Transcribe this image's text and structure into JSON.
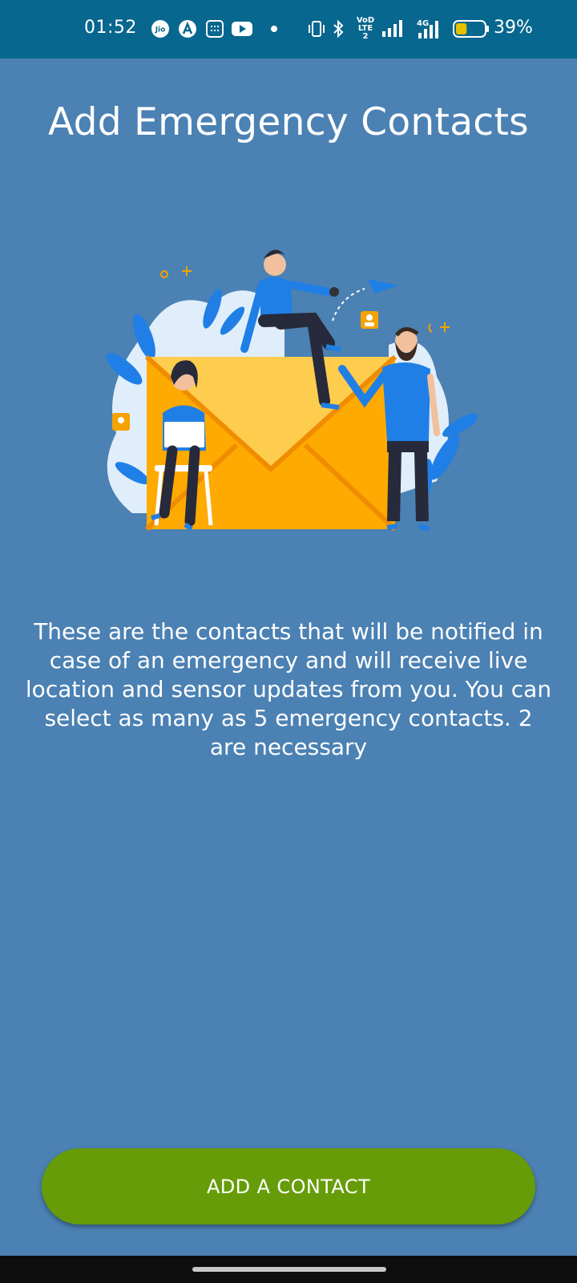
{
  "status_bar": {
    "time": "01:52",
    "battery_percent": "39%",
    "battery_level": 0.39,
    "icons": [
      "jio-icon",
      "app-a-icon",
      "calendar-icon",
      "youtube-icon",
      "dot-icon",
      "vibrate-icon",
      "bluetooth-icon",
      "volte-icon",
      "signal-icon",
      "signal-4g-icon",
      "battery-icon"
    ],
    "net_type_1": "VoD LTE2",
    "net_type_2": "4G"
  },
  "screen": {
    "title": "Add Emergency Contacts",
    "description": "These are the contacts that will be notified in case of an emergency and will receive live location and sensor updates from you. You can select as many as 5 emergency contacts. 2 are necessary",
    "illustration_name": "emergency-contacts-illustration",
    "button_label": "ADD A CONTACT"
  },
  "colors": {
    "background": "#4b81b3",
    "status_bar": "#07678e",
    "button": "#669c08",
    "envelope": "#ffaa00"
  }
}
